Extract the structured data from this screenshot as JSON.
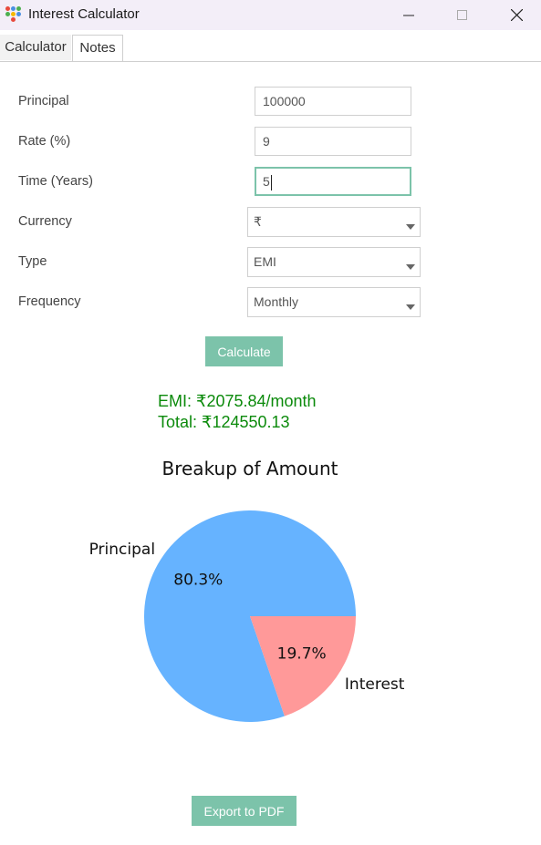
{
  "window": {
    "title": "Interest Calculator",
    "icon": "app-dots-icon"
  },
  "tabs": [
    {
      "label": "Calculator",
      "active": true
    },
    {
      "label": "Notes",
      "active": false
    }
  ],
  "form": {
    "principal": {
      "label": "Principal",
      "value": "100000"
    },
    "rate": {
      "label": "Rate (%)",
      "value": "9"
    },
    "time": {
      "label": "Time (Years)",
      "value": "5"
    },
    "currency": {
      "label": "Currency",
      "value": "₹"
    },
    "type": {
      "label": "Type",
      "value": "EMI"
    },
    "frequency": {
      "label": "Frequency",
      "value": "Monthly"
    }
  },
  "buttons": {
    "calculate": "Calculate",
    "export": "Export to PDF"
  },
  "result": {
    "emi": "EMI: ₹2075.84/month",
    "total": "Total: ₹124550.13"
  },
  "colors": {
    "accent": "#7cc3aa",
    "result_text": "#0b8a0b",
    "principal_slice": "#66b3ff",
    "interest_slice": "#ff9999"
  },
  "chart_data": {
    "type": "pie",
    "title": "Breakup of Amount",
    "categories": [
      "Principal",
      "Interest"
    ],
    "values": [
      80.3,
      19.7
    ],
    "value_labels": [
      "80.3%",
      "19.7%"
    ],
    "colors": [
      "#66b3ff",
      "#ff9999"
    ],
    "start_angle_deg": 0,
    "direction": "counter-clockwise"
  }
}
